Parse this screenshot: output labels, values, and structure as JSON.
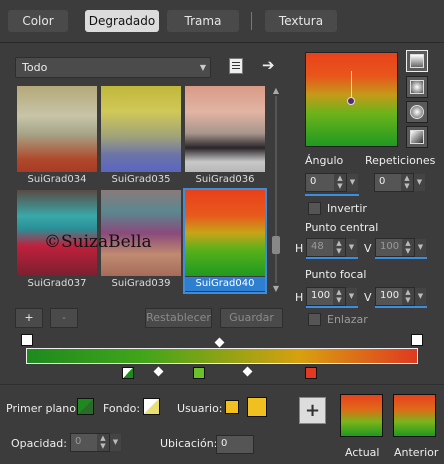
{
  "tabs": [
    "Color",
    "Degradado",
    "Trama",
    "Textura"
  ],
  "filter": {
    "value": "Todo"
  },
  "gradients": [
    {
      "label": "SuiGrad034",
      "bg": "linear-gradient(to bottom, #b5a97a 0%, #c8c4a8 35%, #a6a68a 55%, #b04a2c 85%, #a83a24 100%)"
    },
    {
      "label": "SuiGrad035",
      "bg": "linear-gradient(to bottom, #c0b83a 0%, #d0c858 30%, #9ea07c 60%, #6c74a8 80%, #5a66c0 100%)"
    },
    {
      "label": "SuiGrad036",
      "bg": "linear-gradient(to bottom, #d89a86 0%, #e2b4a4 30%, #a8968c 55%, #2a2428 72%, #c8c8c8 88%, #b8b8b8 100%)"
    },
    {
      "label": "SuiGrad037",
      "bg": "linear-gradient(to bottom, #5a4a44 0%, #3aa8a8 30%, #2a9098 45%, #c0203c 65%, #7a2030 100%)"
    },
    {
      "label": "SuiGrad039",
      "bg": "linear-gradient(to bottom, #8a7a7a 0%, #5a8890 25%, #8a4a7c 50%, #c08a70 75%, #a66c5a 100%)"
    },
    {
      "label": "SuiGrad040",
      "bg": "linear-gradient(to bottom, #e8401c 0%, #e85a1c 30%, #c8a418 50%, #58b01a 70%, #1e9a20 100%)"
    }
  ],
  "watermark": "©SuizaBella",
  "angle": {
    "label": "Ángulo",
    "value": "0"
  },
  "repeats": {
    "label": "Repeticiones",
    "value": "0"
  },
  "invert": {
    "label": "Invertir"
  },
  "center": {
    "label": "Punto central",
    "h_label": "H",
    "h": "48",
    "v_label": "V",
    "v": "100"
  },
  "focal": {
    "label": "Punto focal",
    "h_label": "H",
    "h": "100",
    "v_label": "V",
    "v": "100"
  },
  "link": {
    "label": "Enlazar"
  },
  "buttons": {
    "add": "+",
    "remove": "-",
    "reset": "Restablecer",
    "save": "Guardar"
  },
  "bottom": {
    "primer_plano": "Primer plano:",
    "fondo": "Fondo:",
    "usuario": "Usuario:",
    "opacidad": "Opacidad:",
    "opacidad_value": "0",
    "ubicacion": "Ubicación:",
    "ubicacion_value": "0",
    "actual": "Actual",
    "anterior": "Anterior",
    "plus": "+"
  },
  "colors": {
    "accent": "#3b8de0",
    "user_swatch": "#f0c020",
    "fg": "#1e8a1e"
  }
}
